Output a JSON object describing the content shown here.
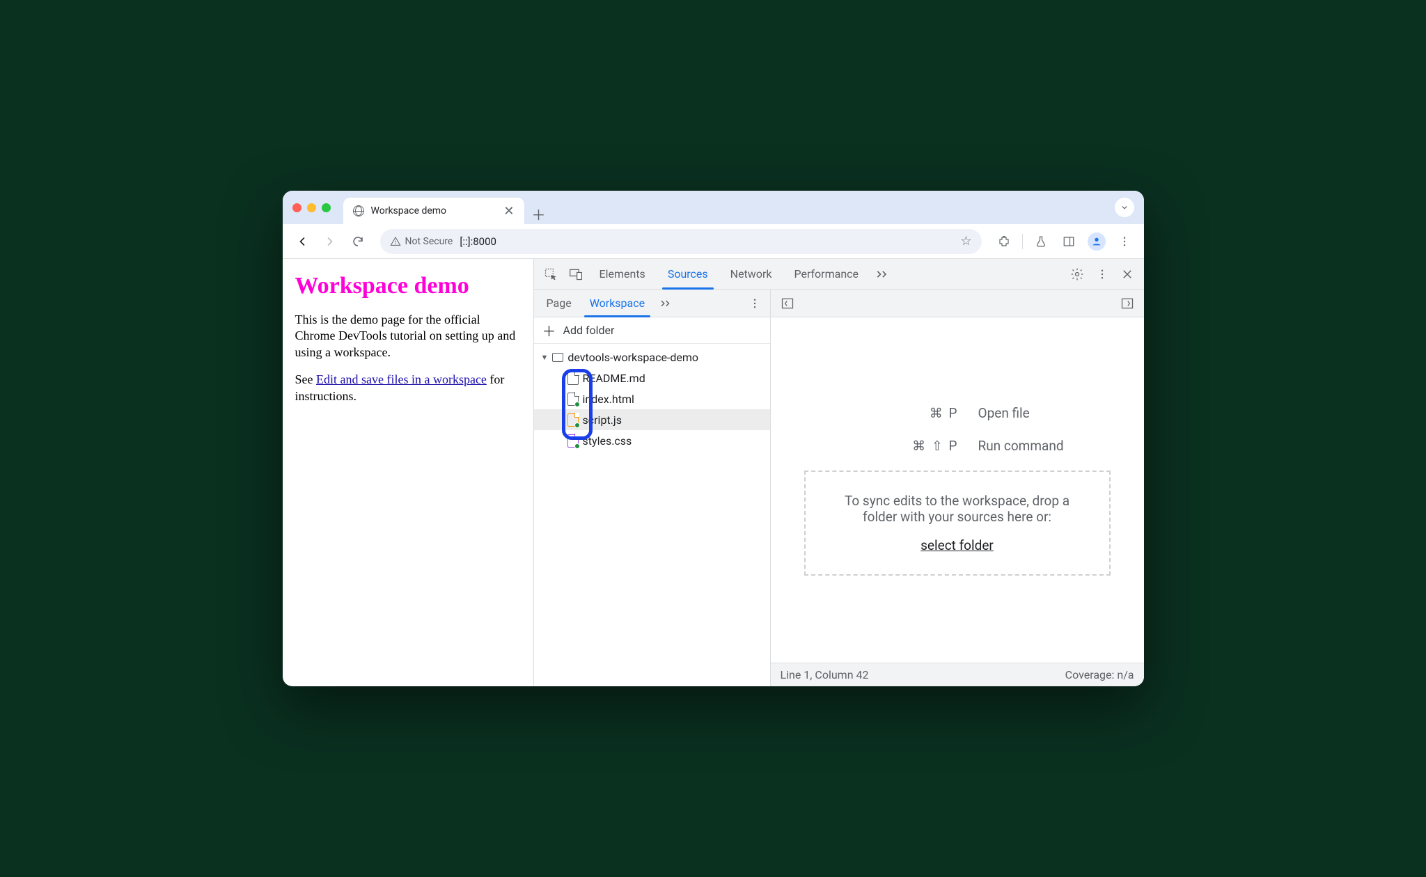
{
  "browser": {
    "tab_title": "Workspace demo",
    "url": "[::]:8000",
    "security_label": "Not Secure"
  },
  "page": {
    "heading": "Workspace demo",
    "p1": "This is the demo page for the official Chrome DevTools tutorial on setting up and using a workspace.",
    "p2_prefix": "See ",
    "p2_link": "Edit and save files in a workspace",
    "p2_suffix": " for instructions."
  },
  "devtools": {
    "tabs": [
      "Elements",
      "Sources",
      "Network",
      "Performance"
    ],
    "active_tab": "Sources",
    "subtabs": [
      "Page",
      "Workspace"
    ],
    "active_subtab": "Workspace",
    "add_folder_label": "Add folder",
    "folder_name": "devtools-workspace-demo",
    "files": [
      {
        "name": "README.md",
        "color": "gray",
        "synced": false
      },
      {
        "name": "index.html",
        "color": "gray",
        "synced": true
      },
      {
        "name": "script.js",
        "color": "orange",
        "synced": true
      },
      {
        "name": "styles.css",
        "color": "purple",
        "synced": true
      }
    ],
    "shortcuts": {
      "open_file_keys": "⌘ P",
      "open_file_label": "Open file",
      "run_cmd_keys": "⌘ ⇧ P",
      "run_cmd_label": "Run command"
    },
    "dropzone": {
      "line": "To sync edits to the workspace, drop a folder with your sources here or:",
      "link": "select folder"
    },
    "status": {
      "cursor": "Line 1, Column 42",
      "coverage": "Coverage: n/a"
    }
  }
}
